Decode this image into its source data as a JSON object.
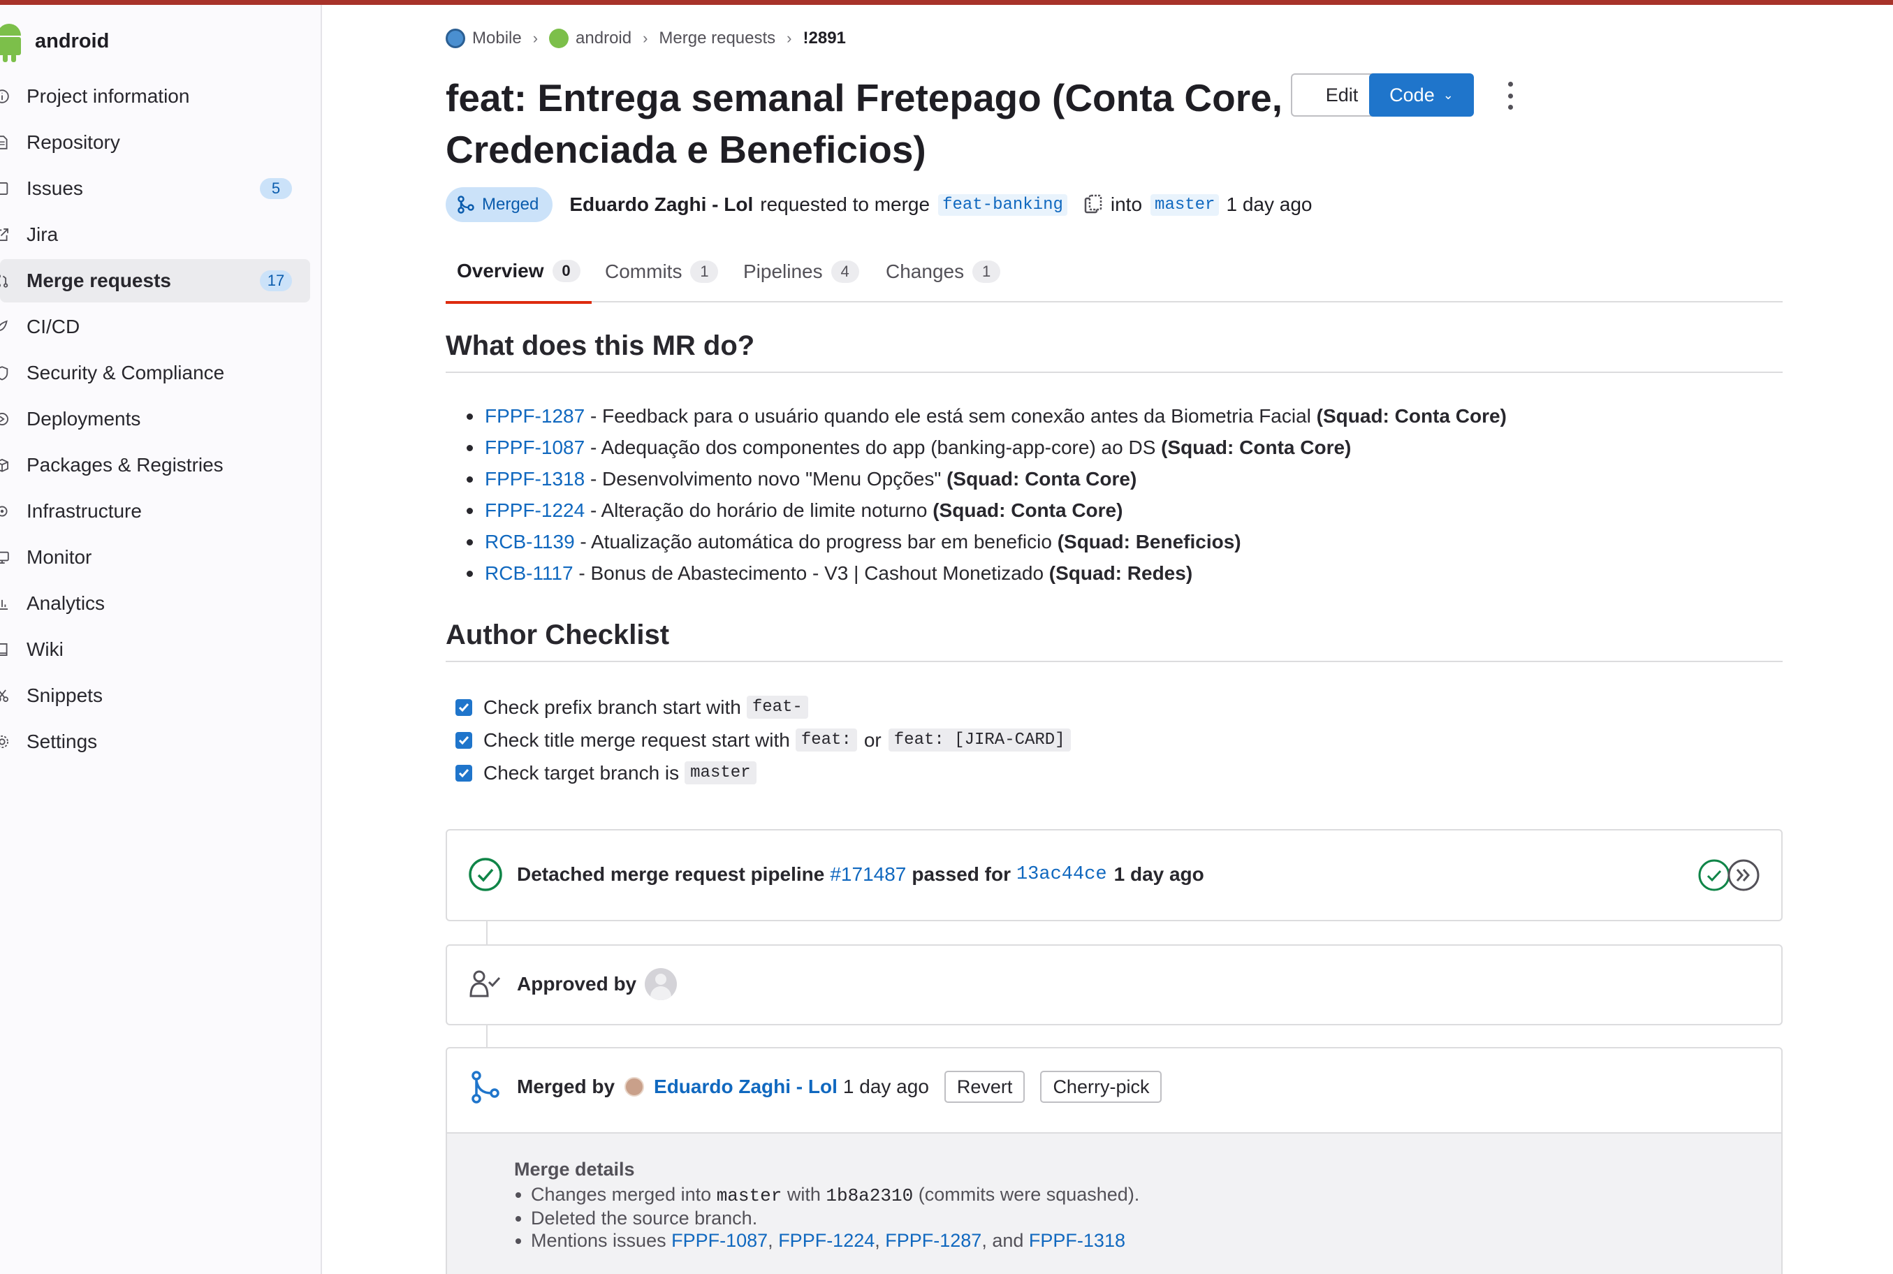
{
  "project": {
    "name": "android"
  },
  "sidebar": {
    "items": [
      {
        "label": "Project information",
        "icon": "info-icon",
        "badge": ""
      },
      {
        "label": "Repository",
        "icon": "document-icon",
        "badge": ""
      },
      {
        "label": "Issues",
        "icon": "issues-icon",
        "badge": "5"
      },
      {
        "label": "Jira",
        "icon": "external-link-icon",
        "badge": ""
      },
      {
        "label": "Merge requests",
        "icon": "merge-request-icon",
        "badge": "17",
        "active": true
      },
      {
        "label": "CI/CD",
        "icon": "rocket-icon",
        "badge": ""
      },
      {
        "label": "Security & Compliance",
        "icon": "shield-icon",
        "badge": ""
      },
      {
        "label": "Deployments",
        "icon": "deployments-icon",
        "badge": ""
      },
      {
        "label": "Packages & Registries",
        "icon": "package-icon",
        "badge": ""
      },
      {
        "label": "Infrastructure",
        "icon": "cloud-gear-icon",
        "badge": ""
      },
      {
        "label": "Monitor",
        "icon": "monitor-icon",
        "badge": ""
      },
      {
        "label": "Analytics",
        "icon": "chart-icon",
        "badge": ""
      },
      {
        "label": "Wiki",
        "icon": "book-icon",
        "badge": ""
      },
      {
        "label": "Snippets",
        "icon": "scissors-icon",
        "badge": ""
      },
      {
        "label": "Settings",
        "icon": "gear-icon",
        "badge": ""
      }
    ]
  },
  "breadcrumb": {
    "items": [
      "Mobile",
      "android",
      "Merge requests",
      "!2891"
    ]
  },
  "mr": {
    "title": "feat: Entrega semanal Fretepago (Conta Core, Rede Credenciada e Beneficios)",
    "status": "Merged",
    "author": "Eduardo Zaghi - Lol",
    "requested_text": "requested to merge",
    "source_branch": "feat-banking",
    "into_text": "into",
    "target_branch": "master",
    "time": "1 day ago"
  },
  "buttons": {
    "edit": "Edit",
    "code": "Code"
  },
  "tabs": [
    {
      "label": "Overview",
      "count": "0"
    },
    {
      "label": "Commits",
      "count": "1"
    },
    {
      "label": "Pipelines",
      "count": "4"
    },
    {
      "label": "Changes",
      "count": "1"
    }
  ],
  "description": {
    "heading": "What does this MR do?",
    "items": [
      {
        "key": "FPPF-1287",
        "text": " - Feedback para o usuário quando ele está sem conexão antes da Biometria Facial ",
        "squad": "(Squad: Conta Core)"
      },
      {
        "key": "FPPF-1087",
        "text": " - Adequação dos componentes do app (banking-app-core) ao DS ",
        "squad": "(Squad: Conta Core)"
      },
      {
        "key": "FPPF-1318",
        "text": " - Desenvolvimento novo \"Menu Opções\" ",
        "squad": "(Squad: Conta Core)"
      },
      {
        "key": "FPPF-1224",
        "text": " - Alteração do horário de limite noturno ",
        "squad": "(Squad: Conta Core)"
      },
      {
        "key": "RCB-1139",
        "text": " - Atualização automática do progress bar em beneficio ",
        "squad": "(Squad: Beneficios)"
      },
      {
        "key": "RCB-1117",
        "text": " - Bonus de Abastecimento - V3 | Cashout Monetizado ",
        "squad": "(Squad: Redes)"
      }
    ]
  },
  "checklist": {
    "heading": "Author Checklist",
    "items": [
      {
        "text": "Check prefix branch start with",
        "code1": "feat-"
      },
      {
        "text": "Check title merge request start with",
        "code1": "feat:",
        "or": "or",
        "code2": "feat: [JIRA-CARD]"
      },
      {
        "text": "Check target branch is",
        "code1": "master"
      }
    ]
  },
  "pipeline": {
    "prefix": "Detached merge request pipeline",
    "id": "#171487",
    "passed_for": "passed for",
    "commit": "13ac44ce",
    "time": "1 day ago"
  },
  "approval": {
    "label": "Approved by"
  },
  "merged": {
    "label": "Merged by",
    "user": "Eduardo Zaghi - Lol",
    "time": "1 day ago",
    "revert": "Revert",
    "cherry_pick": "Cherry-pick"
  },
  "merge_details": {
    "title": "Merge details",
    "line1_a": "Changes merged into",
    "line1_branch": "master",
    "line1_b": "with",
    "line1_sha": "1b8a2310",
    "line1_c": "(commits were squashed).",
    "line2": "Deleted the source branch.",
    "line3_prefix": "Mentions issues",
    "issues": [
      "FPPF-1087",
      "FPPF-1224",
      "FPPF-1287",
      "FPPF-1318"
    ],
    "and": "and"
  },
  "colors": {
    "accent": "#1f75cb",
    "link": "#1068bf",
    "topbar": "#a8332a",
    "success": "#108548",
    "tab_active": "#dd2b0e"
  }
}
